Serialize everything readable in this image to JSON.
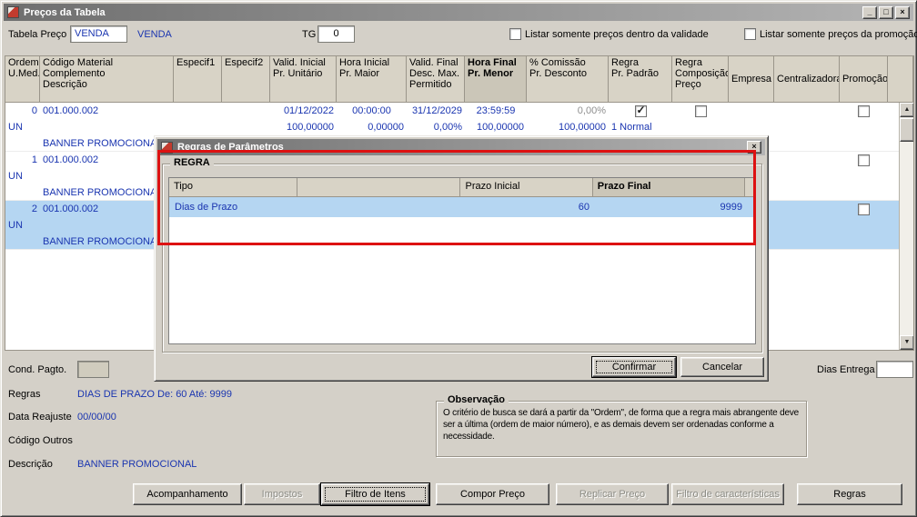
{
  "window": {
    "title": "Preços da Tabela",
    "icons": {
      "minimize": "_",
      "maximize": "□",
      "close": "×",
      "scroll_up": "▲",
      "scroll_down": "▼"
    }
  },
  "toolbar": {
    "tabela_preco_label": "Tabela Preço",
    "tabela_preco_value": "VENDA",
    "tabela_preco_desc": "VENDA",
    "tg_label": "TG",
    "tg_value": "0",
    "chk_validade_label": "Listar somente preços dentro da validade",
    "chk_promocao_label": "Listar somente preços da promoção"
  },
  "grid": {
    "headers": [
      {
        "l1": "Ordem",
        "l2": "U.Med."
      },
      {
        "l1": "Código Material",
        "l2": "Complemento",
        "l3": "Descrição"
      },
      {
        "l1": "Especif1"
      },
      {
        "l1": "Especif2"
      },
      {
        "l1": "Valid. Inicial",
        "l2": "Pr. Unitário"
      },
      {
        "l1": "Hora Inicial",
        "l2": "Pr. Maior"
      },
      {
        "l1": "Valid. Final",
        "l2": "Desc. Max.",
        "l3": "Permitido"
      },
      {
        "l1": "Hora Final",
        "l2": "Pr. Menor",
        "bold": true
      },
      {
        "l1": "% Comissão",
        "l2": "Pr. Desconto"
      },
      {
        "l1": "Regra",
        "l2": "Pr. Padrão"
      },
      {
        "l1": "Regra",
        "l2": "Composição",
        "l3": "Preço"
      },
      {
        "l1": "Empresa"
      },
      {
        "l1": "Centralizadora"
      },
      {
        "l1": "Promoção"
      }
    ],
    "rows": [
      {
        "ordem": "0",
        "codigo": "001.000.002",
        "umed": "UN",
        "descricao": "BANNER PROMOCIONAL",
        "valid_inicial": "01/12/2022",
        "hora_inicial": "00:00:00",
        "valid_final": "31/12/2029",
        "hora_final": "23:59:59",
        "comissao": "0,00%",
        "pr_unitario": "100,00000",
        "pr_maior": "0,00000",
        "desc_max": "0,00%",
        "pr_menor": "100,00000",
        "pr_desconto": "100,00000",
        "regra": "1 Normal",
        "checks": {
          "regra_padrao": true,
          "regra_composicao": false,
          "promocao": false
        },
        "selected": false
      },
      {
        "ordem": "1",
        "codigo": "001.000.002",
        "umed": "UN",
        "descricao": "BANNER PROMOCIONAL",
        "checks": {
          "promocao": false
        },
        "selected": false
      },
      {
        "ordem": "2",
        "codigo": "001.000.002",
        "umed": "UN",
        "descricao": "BANNER PROMOCIONAL",
        "checks": {
          "promocao": false
        },
        "selected": true
      }
    ]
  },
  "dialog": {
    "title": "Regras de Parâmetros",
    "group_label": "REGRA",
    "columns": [
      {
        "label": "Tipo"
      },
      {
        "label": ""
      },
      {
        "label": "Prazo Inicial"
      },
      {
        "label": "Prazo Final",
        "bold": true
      }
    ],
    "row": {
      "tipo": "Dias de Prazo",
      "prazo_inicial": "60",
      "prazo_final": "9999"
    },
    "confirm_label": "Confirmar",
    "cancel_label": "Cancelar"
  },
  "footer": {
    "cond_pagto_label": "Cond. Pagto.",
    "dias_entrega_label": "Dias Entrega",
    "regras_label": "Regras",
    "regras_value": "DIAS DE PRAZO De: 60 Até: 9999",
    "data_reajuste_label": "Data Reajuste",
    "data_reajuste_value": "00/00/00",
    "codigo_outros_label": "Código Outros",
    "descricao_label": "Descrição",
    "descricao_value": "BANNER PROMOCIONAL",
    "observacao_title": "Observação",
    "observacao_text": "O critério de busca se dará a partir da \"Ordem\", de forma que a regra mais abrangente deve ser a última (ordem de maior número), e as demais devem ser ordenadas conforme a necessidade.",
    "buttons": [
      {
        "label": "Acompanhamento",
        "disabled": false
      },
      {
        "label": "Impostos",
        "disabled": true
      },
      {
        "label": "Filtro de Itens",
        "disabled": false
      },
      {
        "label": "Compor Preço",
        "disabled": false
      },
      {
        "label": "Replicar Preço",
        "disabled": true
      },
      {
        "label": "Filtro de características",
        "disabled": true
      },
      {
        "label": "Regras",
        "disabled": false
      }
    ]
  },
  "colors": {
    "data_blue": "#1a35b0",
    "selection_blue": "#b5d6f2",
    "annotation_red": "#dd1111",
    "header_beige": "#d8d3c6"
  }
}
